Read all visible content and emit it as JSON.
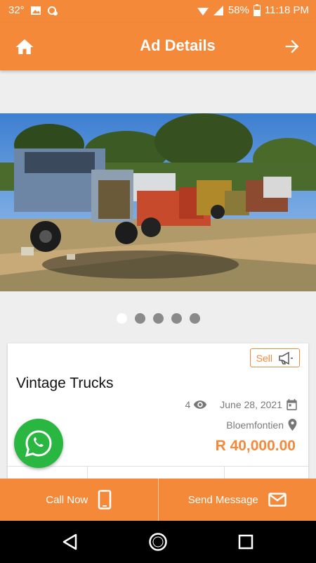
{
  "status_bar": {
    "temperature": "32°",
    "battery": "58%",
    "time": "11:18 PM"
  },
  "app_bar": {
    "title": "Ad Details"
  },
  "gallery": {
    "image_count": 5,
    "active_index": 0
  },
  "ad": {
    "type_badge": "Sell",
    "title": "Vintage Trucks",
    "views": "4",
    "date": "June 28, 2021",
    "location": "Bloemfontien",
    "price": "R 40,000.00"
  },
  "actions": {
    "call_label": "Call Now",
    "message_label": "Send Message"
  },
  "colors": {
    "accent": "#f5893a",
    "whatsapp": "#29b742"
  }
}
